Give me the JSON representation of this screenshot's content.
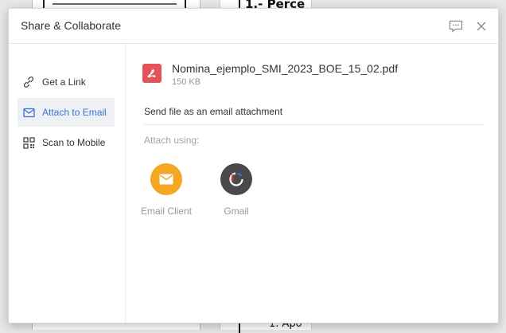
{
  "background": {
    "heading": "1.- Perce",
    "footer": "1. Apo"
  },
  "dialog": {
    "title": "Share & Collaborate",
    "header_icons": [
      "feedback-icon",
      "close-icon"
    ]
  },
  "sidebar": {
    "items": [
      {
        "label": "Get a Link",
        "icon": "link-icon",
        "active": false
      },
      {
        "label": "Attach to Email",
        "icon": "mail-icon",
        "active": true
      },
      {
        "label": "Scan to Mobile",
        "icon": "qr-code-icon",
        "active": false
      }
    ]
  },
  "file": {
    "name": "Nomina_ejemplo_SMI_2023_BOE_15_02.pdf",
    "size": "150 KB",
    "icon": "pdf-file-icon"
  },
  "main": {
    "description": "Send file as an email attachment",
    "attach_label": "Attach using:",
    "options": [
      {
        "label": "Email Client",
        "icon": "envelope-icon",
        "color": "#f5a623"
      },
      {
        "label": "Gmail",
        "icon": "gmail-loading-icon",
        "color": "#4a4a4a"
      }
    ]
  },
  "colors": {
    "accent": "#3a73d8",
    "pdf": "#e4525a",
    "active_bg": "#eef0f4"
  }
}
